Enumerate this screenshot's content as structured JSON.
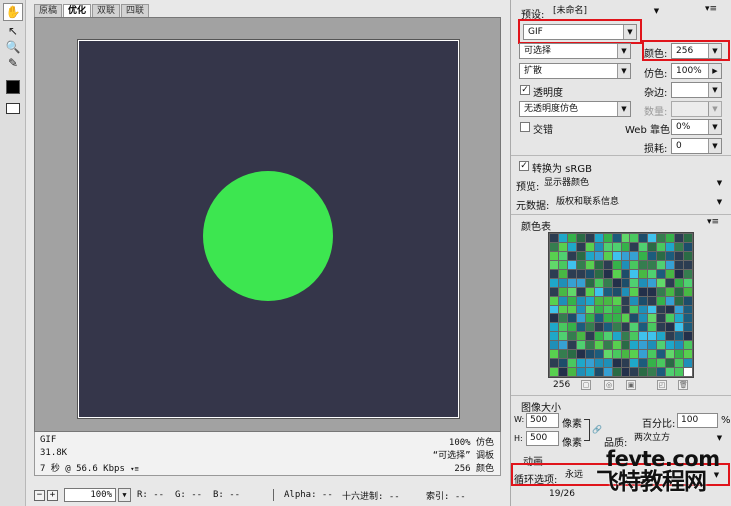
{
  "tabs": [
    "原稿",
    "优化",
    "双联",
    "四联"
  ],
  "active_tab": 1,
  "info": {
    "format": "GIF",
    "size": "31.8K",
    "time": "7 秒 @ 56.6 Kbps",
    "dither": "100% 仿色",
    "palette": "“可选择” 调板",
    "colors": "256 颜色"
  },
  "statusbar": {
    "zoom": "100%",
    "r": "R: --",
    "g": "G: --",
    "b": "B: --",
    "alpha": "Alpha: --",
    "hex": "十六进制: --",
    "index": "索引: --"
  },
  "panel": {
    "preset_label": "预设:",
    "preset_value": "[未命名]",
    "format": "GIF",
    "reduction": "可选择",
    "colors_label": "颜色:",
    "colors_value": "256",
    "dither_algo": "扩散",
    "dither_label": "仿色:",
    "dither_value": "100%",
    "transparency_label": "透明度",
    "matte_label": "杂边:",
    "transparency_dither": "无透明度仿色",
    "amount_label": "数量:",
    "interlaced_label": "交错",
    "web_snap_label": "Web 靠色:",
    "web_snap_value": "0%",
    "lossy_label": "损耗:",
    "lossy_value": "0",
    "srgb_label": "转换为 sRGB",
    "preview_label": "预览:",
    "preview_value": "显示器颜色",
    "metadata_label": "元数据:",
    "metadata_value": "版权和联系信息",
    "color_table_title": "颜色表",
    "color_count": "256",
    "image_size_title": "图像大小",
    "w_label": "W:",
    "w_value": "500",
    "h_label": "H:",
    "h_value": "500",
    "px_label": "像素",
    "percent_label": "百分比:",
    "percent_value": "100",
    "percent_sign": "%",
    "quality_label": "品质:",
    "quality_value": "两次立方",
    "animation_title": "动画",
    "loop_label": "循环选项:",
    "loop_value": "永远",
    "frame_counter": "19/26"
  },
  "watermark": {
    "domain": "fevte.com",
    "name": "飞特教程网"
  },
  "colors": {
    "artboard": "#35364a",
    "circle": "#3de650",
    "highlight": "#e0141b"
  },
  "palette_colors": [
    "#1f8fb8",
    "#35b24a",
    "#58d04f",
    "#2a6b45",
    "#1d4d6a",
    "#36a0d3",
    "#49c85f",
    "#2c3d52",
    "#1fa7c9",
    "#61d86a",
    "#357d4f",
    "#23304a",
    "#3fc2ec",
    "#48b844",
    "#1c5c7c",
    "#4fd070"
  ]
}
